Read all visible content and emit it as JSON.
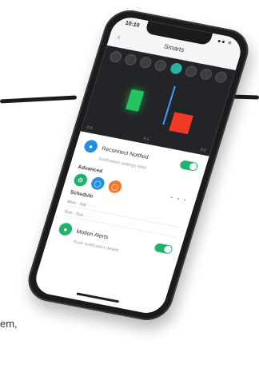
{
  "caption": {
    "text": "em,"
  },
  "phone": {
    "status": {
      "time": "10:10",
      "icons": "●● ≡"
    },
    "titlebar": {
      "back": "‹",
      "title": "Smarts"
    },
    "video": {
      "tools": [
        "tool-1",
        "tool-2",
        "tool-3",
        "tool-4",
        "tool-5",
        "tool-6",
        "tool-7",
        "tool-8"
      ],
      "active_tool_index": 4,
      "axis": [
        "0.0",
        "0.1",
        "0.2"
      ]
    },
    "settings": {
      "feature_toggle": {
        "label": "Reconnect Notified",
        "sub": "Notification settings label",
        "icon": "bell-icon",
        "on": true
      },
      "section_1": {
        "title": "Advanced",
        "icons": [
          "settings-icon",
          "shield-icon",
          "alarm-icon"
        ],
        "dots": "• • •"
      },
      "section_2": {
        "title": "Schedule",
        "rows": [
          "Mon - Sat  · · · ·",
          "Sun - Sun  · · · ·"
        ]
      },
      "bottom_toggle": {
        "label": "Motion Alerts",
        "sub": "Push notification details",
        "icon": "camera-icon",
        "on": true
      }
    },
    "colors": {
      "accent": "#21b36b",
      "blue": "#1f8fe0",
      "orange": "#f07a2b",
      "roi_green": "#22c55e",
      "roi_red": "#ef3b24"
    }
  }
}
